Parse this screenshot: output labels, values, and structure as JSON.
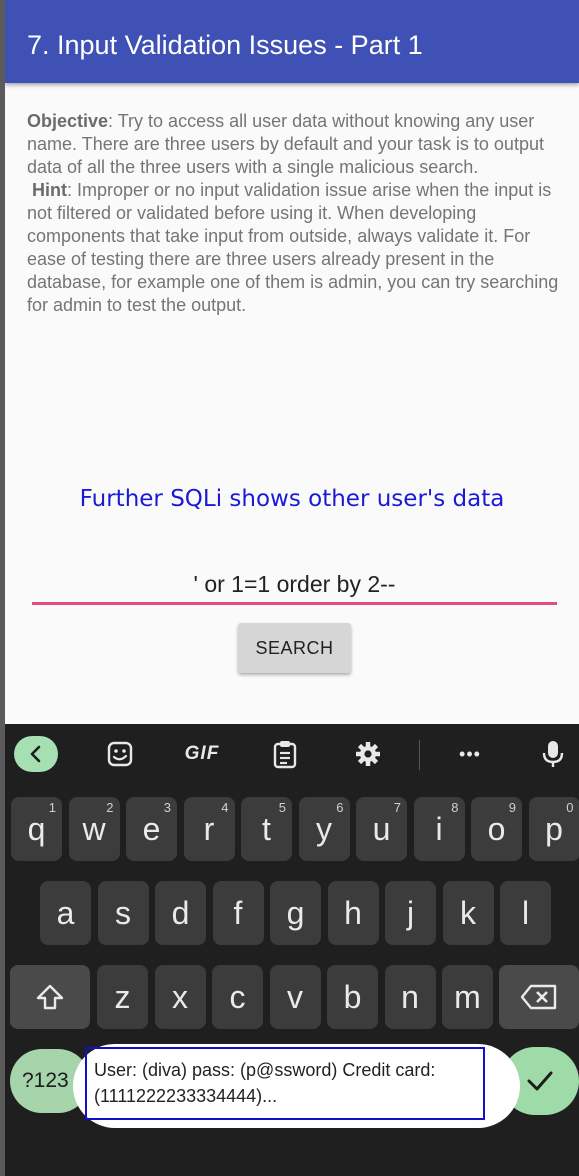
{
  "app": {
    "title": "7. Input Validation Issues - Part 1",
    "colors": {
      "appbar": "#3f51b5",
      "input_underline": "#e34d84",
      "result_text": "#1a1ad6"
    }
  },
  "content": {
    "objective_label": "Objective",
    "objective_text": ": Try to access all user data without knowing any user name. There are three users by default and your task is to output data of all the three users with a single malicious search.",
    "hint_label": "Hint",
    "hint_text": ": Improper or no input validation issue arise when the input is not filtered or validated before using it. When developing components that take input from outside, always validate it. For ease of testing there are three users already present in the database, for example one of them is admin, you can try searching for admin to test the output.",
    "result_text": "Further SQLi shows other user's data",
    "search_input_value": "' or 1=1 order by 2--",
    "search_button_label": "SEARCH"
  },
  "keyboard": {
    "toolbar": {
      "back": "chevron-left-icon",
      "sticker": "sticker-icon",
      "gif": "GIF",
      "clipboard": "clipboard-icon",
      "settings": "gear-icon",
      "more": "•••",
      "mic": "microphone-icon"
    },
    "row1": [
      {
        "key": "q",
        "hint": "1"
      },
      {
        "key": "w",
        "hint": "2"
      },
      {
        "key": "e",
        "hint": "3"
      },
      {
        "key": "r",
        "hint": "4"
      },
      {
        "key": "t",
        "hint": "5"
      },
      {
        "key": "y",
        "hint": "6"
      },
      {
        "key": "u",
        "hint": "7"
      },
      {
        "key": "i",
        "hint": "8"
      },
      {
        "key": "o",
        "hint": "9"
      },
      {
        "key": "p",
        "hint": "0"
      }
    ],
    "row2": [
      "a",
      "s",
      "d",
      "f",
      "g",
      "h",
      "j",
      "k",
      "l"
    ],
    "row3": [
      "z",
      "x",
      "c",
      "v",
      "b",
      "n",
      "m"
    ],
    "symbols_label": "?123",
    "suggestion_line1": "User: (diva) pass: (p@ssword) Credit card:",
    "suggestion_line2": "(1111222233334444)..."
  }
}
